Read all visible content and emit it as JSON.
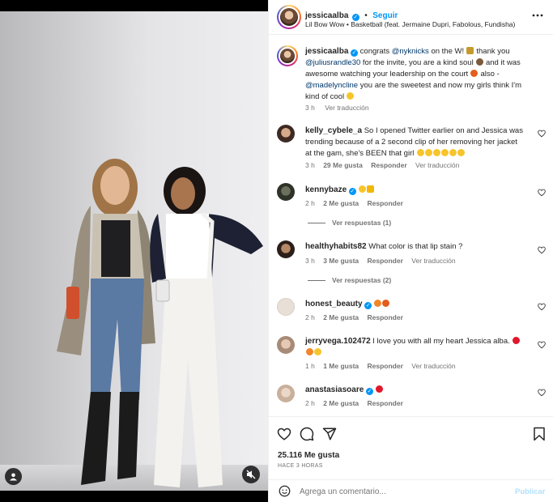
{
  "post": {
    "author": "jessicaalba",
    "follow_label": "Seguir",
    "dot": "•",
    "audio": "Lil Bow Wow • Basketball (feat. Jermaine Dupri, Fabolous, Fundisha)",
    "caption_segments": [
      "congrats ",
      "@nyknicks",
      " on the W! ",
      " thank you",
      "@juliusrandle30",
      " for the invite, you are a kind soul ",
      " and it was",
      "awesome watching your leadership on the court ",
      " also -",
      "@madelyncline",
      " you are the sweetest and now my girls think I'm",
      "kind of cool "
    ],
    "caption_time": "3 h",
    "caption_translate": "Ver traducción",
    "likes": "25.116 Me gusta",
    "time_ago": "HACE 3 HORAS"
  },
  "comments": [
    {
      "user": "kelly_cybele_a",
      "lines": [
        "So I opened Twitter earlier on and Jessica was",
        "trending because of a 2 second clip of her removing her jacket",
        "at the gam, she's BEEN that girl "
      ],
      "time": "3 h",
      "likes": "29 Me gusta",
      "reply": "Responder",
      "translate": "Ver traducción"
    },
    {
      "user": "kennybaze",
      "lines": [
        ""
      ],
      "time": "2 h",
      "likes": "2 Me gusta",
      "reply": "Responder",
      "view_replies": "Ver respuestas (1)"
    },
    {
      "user": "healthyhabits82",
      "lines": [
        "What color is that lip stain ?"
      ],
      "time": "3 h",
      "likes": "3 Me gusta",
      "reply": "Responder",
      "translate": "Ver traducción",
      "view_replies": "Ver respuestas (2)"
    },
    {
      "user": "honest_beauty",
      "lines": [
        ""
      ],
      "time": "2 h",
      "likes": "2 Me gusta",
      "reply": "Responder"
    },
    {
      "user": "jerryvega.102472",
      "lines": [
        "I love you with all my heart Jessica alba. "
      ],
      "time": "1 h",
      "likes": "1 Me gusta",
      "reply": "Responder",
      "translate": "Ver traducción"
    },
    {
      "user": "anastasiasoare",
      "lines": [
        ""
      ],
      "time": "2 h",
      "likes": "2 Me gusta",
      "reply": "Responder"
    }
  ],
  "composer": {
    "placeholder": "Agrega un comentario...",
    "publish": "Publicar"
  },
  "icons": {
    "more": "more-options-icon",
    "like": "heart-icon",
    "comment": "comment-icon",
    "share": "share-icon",
    "save": "bookmark-icon",
    "emoji": "emoji-icon",
    "mute": "muted-audio-icon",
    "tag": "user-tag-icon"
  },
  "colors": {
    "verified": "#0095f6",
    "link": "#00376b",
    "publish_disabled": "#b2dffc",
    "muted_text": "#737373"
  }
}
